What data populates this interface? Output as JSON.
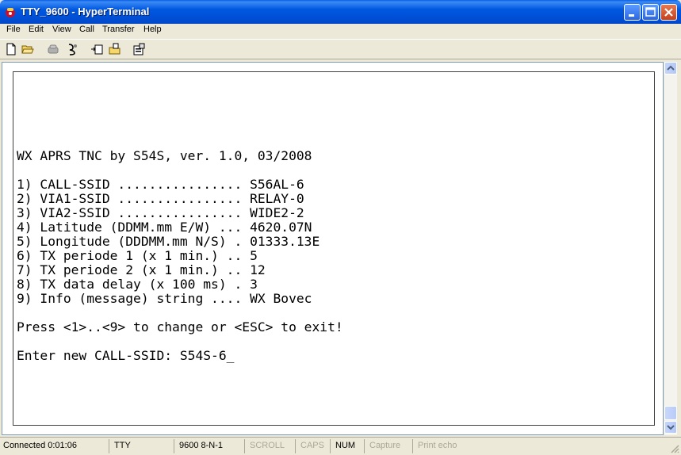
{
  "window": {
    "title": "TTY_9600 - HyperTerminal",
    "app_icon": "hyperterminal-phone-icon"
  },
  "menu": [
    "File",
    "Edit",
    "View",
    "Call",
    "Transfer",
    "Help"
  ],
  "toolbar": {
    "icons": [
      "new-file-icon",
      "open-folder-icon",
      "call-icon",
      "disconnect-icon",
      "send-icon",
      "receive-icon",
      "properties-icon"
    ]
  },
  "terminal": {
    "lines": [
      "WX APRS TNC by S54S, ver. 1.0, 03/2008",
      "",
      "1) CALL-SSID ................ S56AL-6",
      "2) VIA1-SSID ................ RELAY-0",
      "3) VIA2-SSID ................ WIDE2-2",
      "4) Latitude (DDMM.mm E/W) ... 4620.07N",
      "5) Longitude (DDDMM.mm N/S) . 01333.13E",
      "6) TX periode 1 (x 1 min.) .. 5",
      "7) TX periode 2 (x 1 min.) .. 12",
      "8) TX data delay (x 100 ms) . 3",
      "9) Info (message) string .... WX Bovec",
      "",
      "Press <1>..<9> to change or <ESC> to exit!",
      "",
      "Enter new CALL-SSID: S54S-6"
    ],
    "cursor": "_"
  },
  "status": {
    "connected": "Connected 0:01:06",
    "emulation": "TTY",
    "settings": "9600 8-N-1",
    "scroll": "SCROLL",
    "caps": "CAPS",
    "num": "NUM",
    "capture": "Capture",
    "print_echo": "Print echo"
  }
}
